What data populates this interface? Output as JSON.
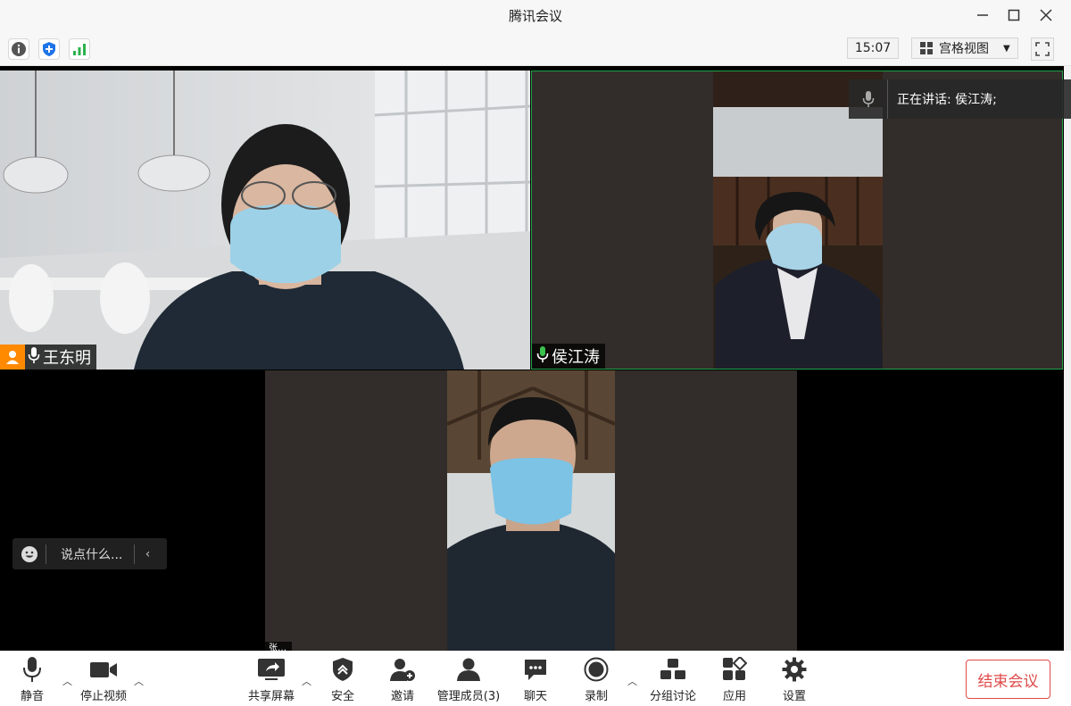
{
  "window": {
    "title": "腾讯会议"
  },
  "toolbar": {
    "time": "15:07",
    "view_label": "宫格视图",
    "icons": [
      "info-icon",
      "shield-icon",
      "signal-icon"
    ]
  },
  "speaking": {
    "text": "正在讲话: 侯江涛;"
  },
  "participants": [
    {
      "name": "王东明",
      "status": "mic-on"
    },
    {
      "name": "侯江涛",
      "status": "mic-on-speaking"
    },
    {
      "name": "张…",
      "status": "mic-on"
    }
  ],
  "chat": {
    "placeholder": "说点什么..."
  },
  "bottom": {
    "mute": "静音",
    "stop_video": "停止视频",
    "share": "共享屏幕",
    "security": "安全",
    "invite": "邀请",
    "members": "管理成员(3)",
    "chat": "聊天",
    "record": "录制",
    "breakout": "分组讨论",
    "apps": "应用",
    "settings": "设置",
    "end": "结束会议"
  },
  "colors": {
    "end_red": "#e04a4a",
    "active_border": "#21a34a",
    "mic_green": "#39c24c",
    "user_orange": "#ff8a00"
  }
}
